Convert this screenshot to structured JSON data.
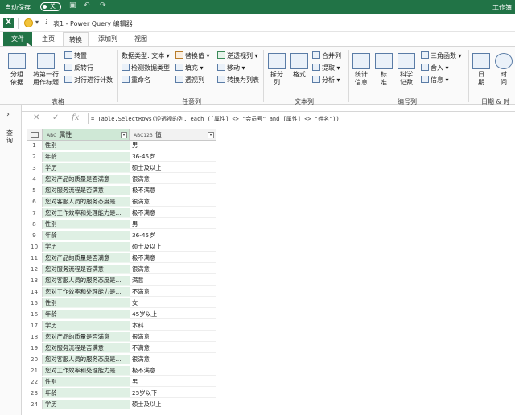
{
  "titlebar": {
    "autosave_label": "自动保存",
    "autosave_state": "关",
    "workbook_label": "工作簿"
  },
  "pq_window": {
    "title": "表1 - Power Query 编辑器"
  },
  "tabs": [
    {
      "id": "file",
      "label": "文件"
    },
    {
      "id": "home",
      "label": "主页"
    },
    {
      "id": "transform",
      "label": "转换"
    },
    {
      "id": "addcol",
      "label": "添加列"
    },
    {
      "id": "view",
      "label": "视图"
    }
  ],
  "ribbon": {
    "group_table": {
      "name": "表格",
      "group_by": "分组\n依据",
      "use_first_row": "将第一行\n用作标题",
      "transpose": "转置",
      "reverse_rows": "反转行",
      "count_rows": "对行进行计数"
    },
    "group_anycol": {
      "name": "任意列",
      "data_type": "数据类型: 文本",
      "detect_type": "检测数据类型",
      "rename": "重命名",
      "replace_values": "替换值",
      "fill": "填充",
      "pivot_column": "透视列",
      "unpivot": "逆透视列",
      "move": "移动",
      "convert_to_list": "转换为列表"
    },
    "group_textcol": {
      "name": "文本列",
      "split_column": "拆分\n列",
      "format": "格式",
      "merge_columns": "合并列",
      "extract": "提取",
      "parse": "分析"
    },
    "group_numcol": {
      "name": "编号列",
      "statistics": "统计\n信息",
      "standard": "标\n准",
      "scientific": "科学\n记数",
      "trig": "三角函数",
      "rounding": "舍入",
      "info": "信息"
    },
    "group_datetime": {
      "name": "日期 & 时",
      "date": "日\n期",
      "time": "时\n间"
    }
  },
  "query_pane": {
    "label": "查询"
  },
  "formula_bar": {
    "formula": "= Table.SelectRows(逆透视的列, each ([属性] <> \"会员号\" and [属性] <> \"姓名\"))"
  },
  "grid": {
    "col1": {
      "type_icon": "ABC",
      "header": "属性"
    },
    "col2": {
      "type_icon": "ABC123",
      "header": "值"
    },
    "rows": [
      {
        "n": "1",
        "attr": "性别",
        "val": "男"
      },
      {
        "n": "2",
        "attr": "年龄",
        "val": "36-45岁"
      },
      {
        "n": "3",
        "attr": "学历",
        "val": "硕士及以上"
      },
      {
        "n": "4",
        "attr": "您对产品的质量是否满意",
        "val": "很满意"
      },
      {
        "n": "5",
        "attr": "您对服务流程是否满意",
        "val": "极不满意"
      },
      {
        "n": "6",
        "attr": "您对客服人员的服务态度是...",
        "val": "很满意"
      },
      {
        "n": "7",
        "attr": "您对工作效率和处理能力是...",
        "val": "极不满意"
      },
      {
        "n": "8",
        "attr": "性别",
        "val": "男"
      },
      {
        "n": "9",
        "attr": "年龄",
        "val": "36-45岁"
      },
      {
        "n": "10",
        "attr": "学历",
        "val": "硕士及以上"
      },
      {
        "n": "11",
        "attr": "您对产品的质量是否满意",
        "val": "极不满意"
      },
      {
        "n": "12",
        "attr": "您对服务流程是否满意",
        "val": "很满意"
      },
      {
        "n": "13",
        "attr": "您对客服人员的服务态度是...",
        "val": "满意"
      },
      {
        "n": "14",
        "attr": "您对工作效率和处理能力是...",
        "val": "不满意"
      },
      {
        "n": "15",
        "attr": "性别",
        "val": "女"
      },
      {
        "n": "16",
        "attr": "年龄",
        "val": "45岁以上"
      },
      {
        "n": "17",
        "attr": "学历",
        "val": "本科"
      },
      {
        "n": "18",
        "attr": "您对产品的质量是否满意",
        "val": "很满意"
      },
      {
        "n": "19",
        "attr": "您对服务流程是否满意",
        "val": "不满意"
      },
      {
        "n": "20",
        "attr": "您对客服人员的服务态度是...",
        "val": "很满意"
      },
      {
        "n": "21",
        "attr": "您对工作效率和处理能力是...",
        "val": "极不满意"
      },
      {
        "n": "22",
        "attr": "性别",
        "val": "男"
      },
      {
        "n": "23",
        "attr": "年龄",
        "val": "25岁以下"
      },
      {
        "n": "24",
        "attr": "学历",
        "val": "硕士及以上"
      }
    ]
  },
  "colors": {
    "excel_green": "#217346",
    "selected_column": "#dff0e4"
  }
}
